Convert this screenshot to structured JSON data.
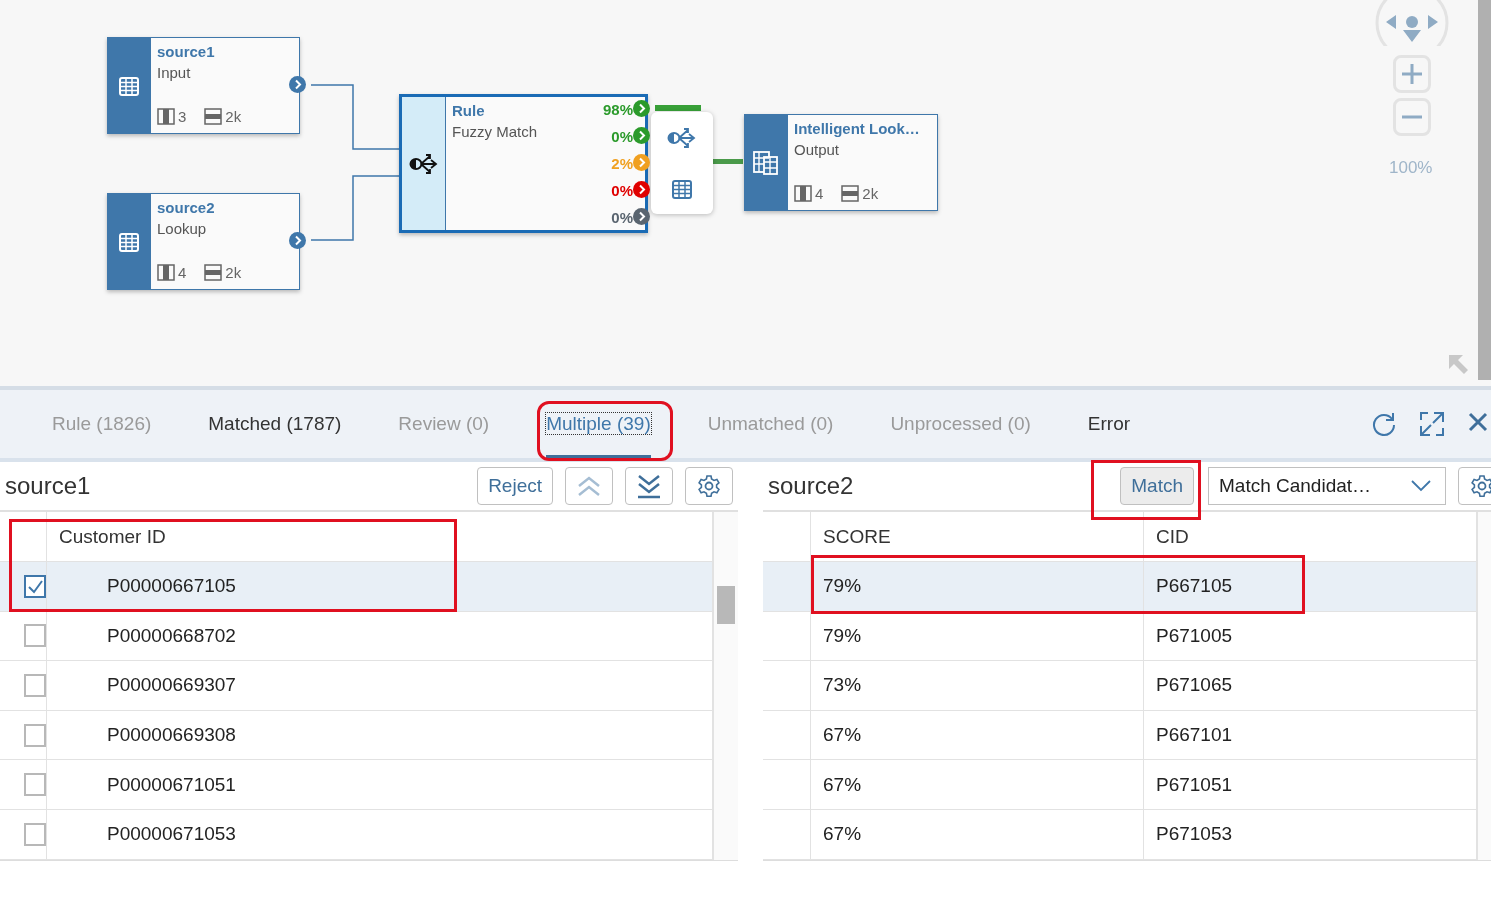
{
  "canvas": {
    "sources": [
      {
        "title": "source1",
        "subtitle": "Input",
        "columns": "3",
        "rows": "2k"
      },
      {
        "title": "source2",
        "subtitle": "Lookup",
        "columns": "4",
        "rows": "2k"
      }
    ],
    "rule": {
      "title": "Rule",
      "subtitle": "Fuzzy Match",
      "outputs": [
        {
          "label": "98%",
          "color": "#2b9a2b"
        },
        {
          "label": "0%",
          "color": "#2b9a2b"
        },
        {
          "label": "2%",
          "color": "#f0a020"
        },
        {
          "label": "0%",
          "color": "#e00000"
        },
        {
          "label": "0%",
          "color": "#5a6570"
        }
      ]
    },
    "output": {
      "title": "Intelligent Look…",
      "subtitle": "Output",
      "columns": "4",
      "rows": "2k"
    },
    "zoom_label": "100%"
  },
  "tabs": [
    {
      "label": "Rule (1826)",
      "selected": false,
      "disabled": true
    },
    {
      "label": "Matched (1787)",
      "selected": false,
      "disabled": false
    },
    {
      "label": "Review (0)",
      "selected": false,
      "disabled": true
    },
    {
      "label": "Multiple (39)",
      "selected": true,
      "disabled": false
    },
    {
      "label": "Unmatched (0)",
      "selected": false,
      "disabled": true
    },
    {
      "label": "Unprocessed (0)",
      "selected": false,
      "disabled": true
    },
    {
      "label": "Error",
      "selected": false,
      "disabled": false
    }
  ],
  "left": {
    "title": "source1",
    "button": "Reject",
    "column": "Customer ID",
    "rows": [
      {
        "id": "P00000667105",
        "checked": true
      },
      {
        "id": "P00000668702",
        "checked": false
      },
      {
        "id": "P00000669307",
        "checked": false
      },
      {
        "id": "P00000669308",
        "checked": false
      },
      {
        "id": "P00000671051",
        "checked": false
      },
      {
        "id": "P00000671053",
        "checked": false
      }
    ]
  },
  "right": {
    "title": "source2",
    "button": "Match",
    "select": "Match Candidat…",
    "columns": [
      "SCORE",
      "CID"
    ],
    "rows": [
      {
        "score": "79%",
        "cid": "P667105",
        "selected": true
      },
      {
        "score": "79%",
        "cid": "P671005",
        "selected": false
      },
      {
        "score": "73%",
        "cid": "P671065",
        "selected": false
      },
      {
        "score": "67%",
        "cid": "P667101",
        "selected": false
      },
      {
        "score": "67%",
        "cid": "P671051",
        "selected": false
      },
      {
        "score": "67%",
        "cid": "P671053",
        "selected": false
      }
    ]
  }
}
